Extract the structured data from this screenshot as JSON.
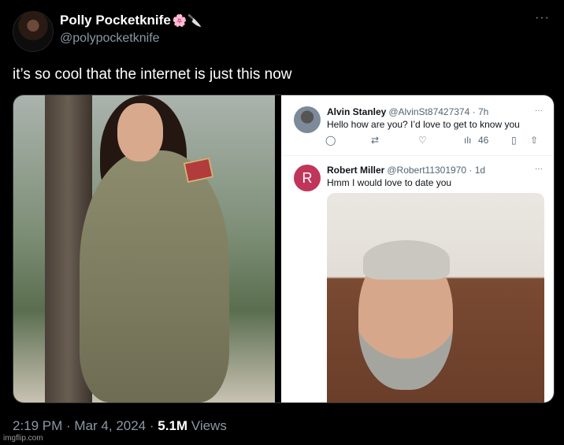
{
  "author": {
    "name": "Polly Pocketknife",
    "name_emojis": "🌸🔪",
    "handle": "@polypocketknife"
  },
  "tweet": {
    "text": "it’s so cool that the internet is just this now",
    "more_icon": "more-icon"
  },
  "replies": [
    {
      "name": "Alvin Stanley",
      "handle": "@AlvinSt87427374 · 7h",
      "text": "Hello how are you? I’d love to get to know you",
      "views": "46"
    },
    {
      "name": "Robert Miller",
      "handle": "@Robert11301970 · 1d",
      "text": "Hmm I would love to date you",
      "avatar_letter": "R"
    }
  ],
  "footer": {
    "time": "2:19 PM",
    "date": "Mar 4, 2024",
    "views_count": "5.1M",
    "views_label": "Views"
  },
  "watermark": "imgflip.com",
  "colors": {
    "background": "#000000",
    "muted": "#8b98a5",
    "reply_avatar": "#c0355a"
  }
}
